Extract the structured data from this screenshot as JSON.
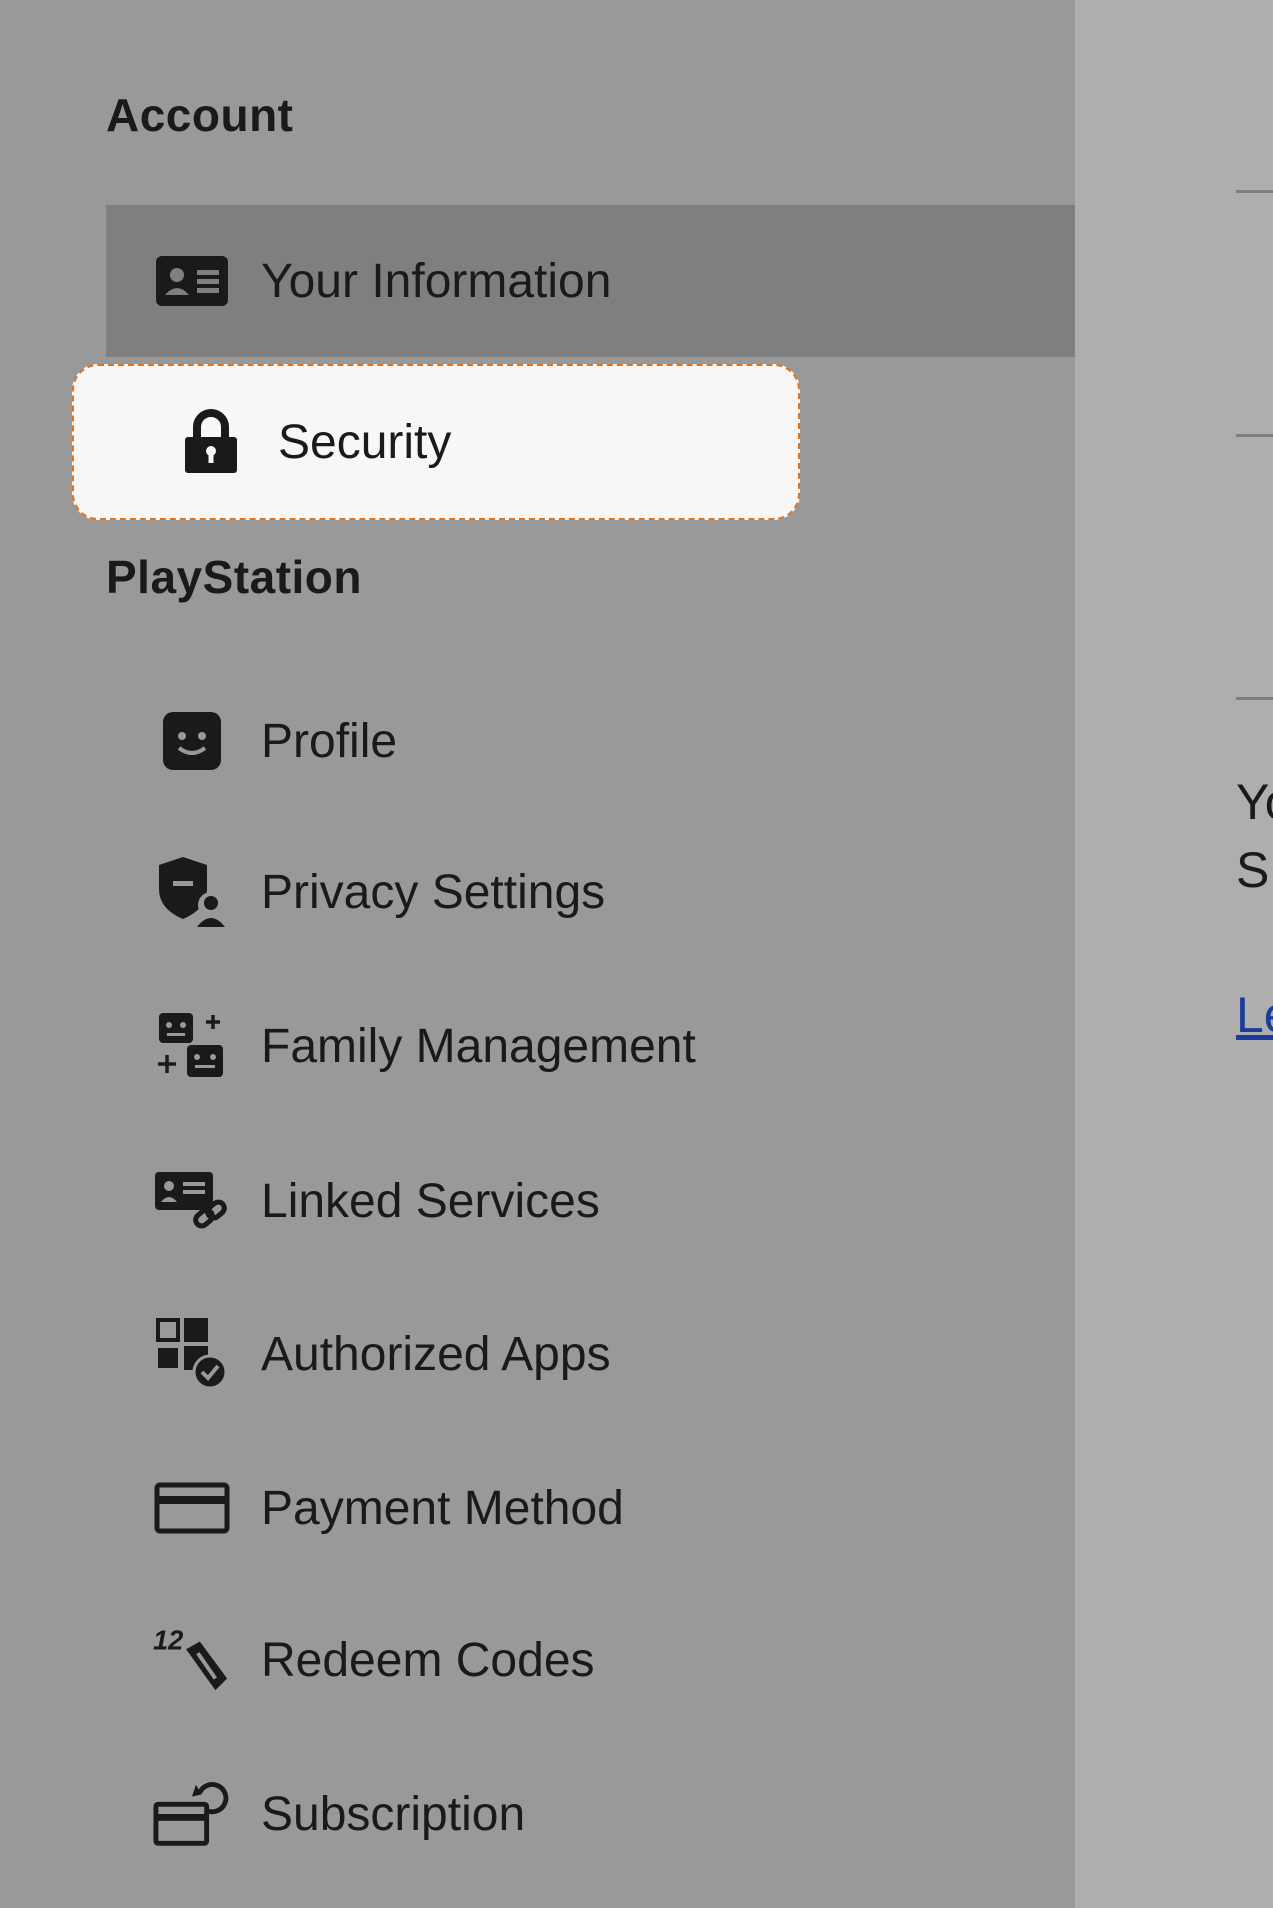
{
  "sidebar": {
    "account_heading": "Account",
    "playstation_heading": "PlayStation",
    "items": [
      {
        "label": "Your Information",
        "icon": "id-card-icon"
      },
      {
        "label": "Security",
        "icon": "lock-icon"
      },
      {
        "label": "Profile",
        "icon": "smiley-face-icon"
      },
      {
        "label": "Privacy Settings",
        "icon": "shield-user-icon"
      },
      {
        "label": "Family Management",
        "icon": "family-icon"
      },
      {
        "label": "Linked Services",
        "icon": "linked-card-icon"
      },
      {
        "label": "Authorized Apps",
        "icon": "apps-check-icon"
      },
      {
        "label": "Payment Method",
        "icon": "credit-card-icon"
      },
      {
        "label": "Redeem Codes",
        "icon": "redeem-code-icon"
      },
      {
        "label": "Subscription",
        "icon": "subscription-icon"
      }
    ]
  },
  "main": {
    "text_line_1": "Yo",
    "text_line_2": "S",
    "link_text": "Le"
  },
  "colors": {
    "sidebar_bg": "#999999",
    "active_bg": "#7f7f7f",
    "focus_bg": "#f7f7f7",
    "focus_border": "#e0731c"
  }
}
